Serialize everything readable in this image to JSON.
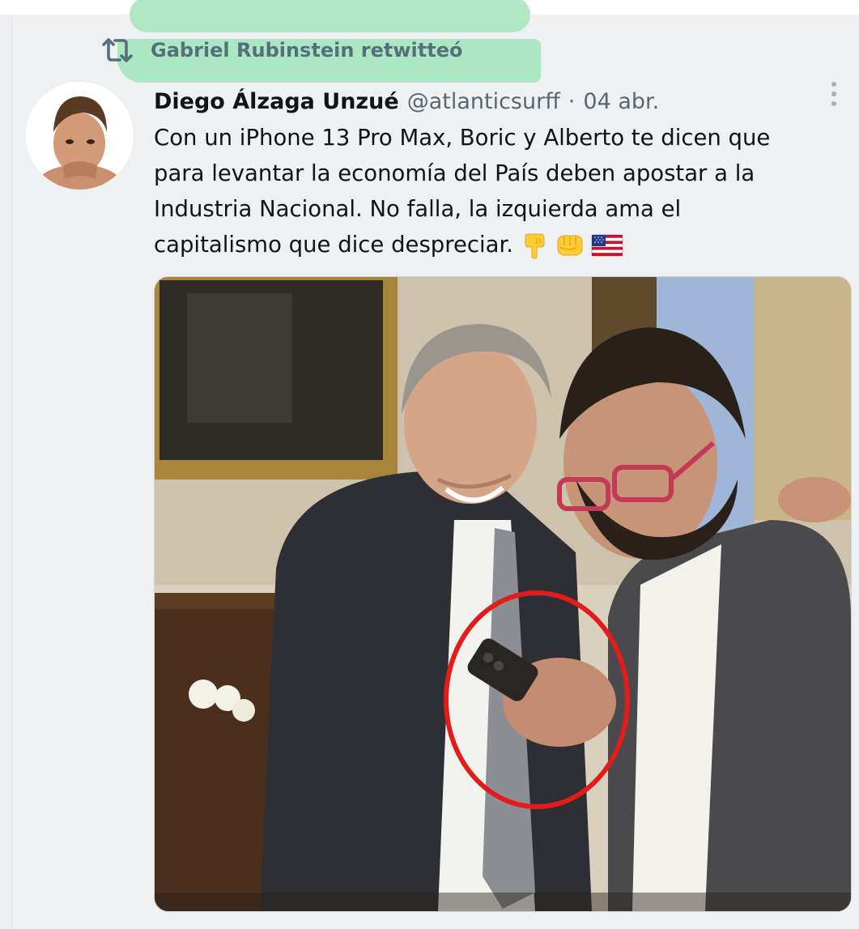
{
  "retweet": {
    "label": "Gabriel Rubinstein retwitteó",
    "icon": "retweet-icon",
    "color": "#55707a"
  },
  "tweet": {
    "author_name": "Diego Álzaga Unzué",
    "handle": "@atlanticsurff",
    "separator": "·",
    "date": "04 abr.",
    "text_lines": [
      "Con un iPhone 13 Pro Max, Boric y Alberto te dicen que",
      "para levantar la economía del País deben apostar a la",
      "Industria Nacional. No falla, la izquierda ama el",
      "capitalismo que dice despreciar."
    ],
    "emojis": [
      "backhand-index-pointing-down",
      "oncoming-fist",
      "flag-united-states"
    ]
  },
  "icons": {
    "more": "more-vertical-icon",
    "avatar": "avatar"
  },
  "colors": {
    "highlight": "#a8e6c0",
    "annotation_circle": "#e31b1b",
    "text_primary": "#0f1419",
    "text_secondary": "#586872"
  }
}
